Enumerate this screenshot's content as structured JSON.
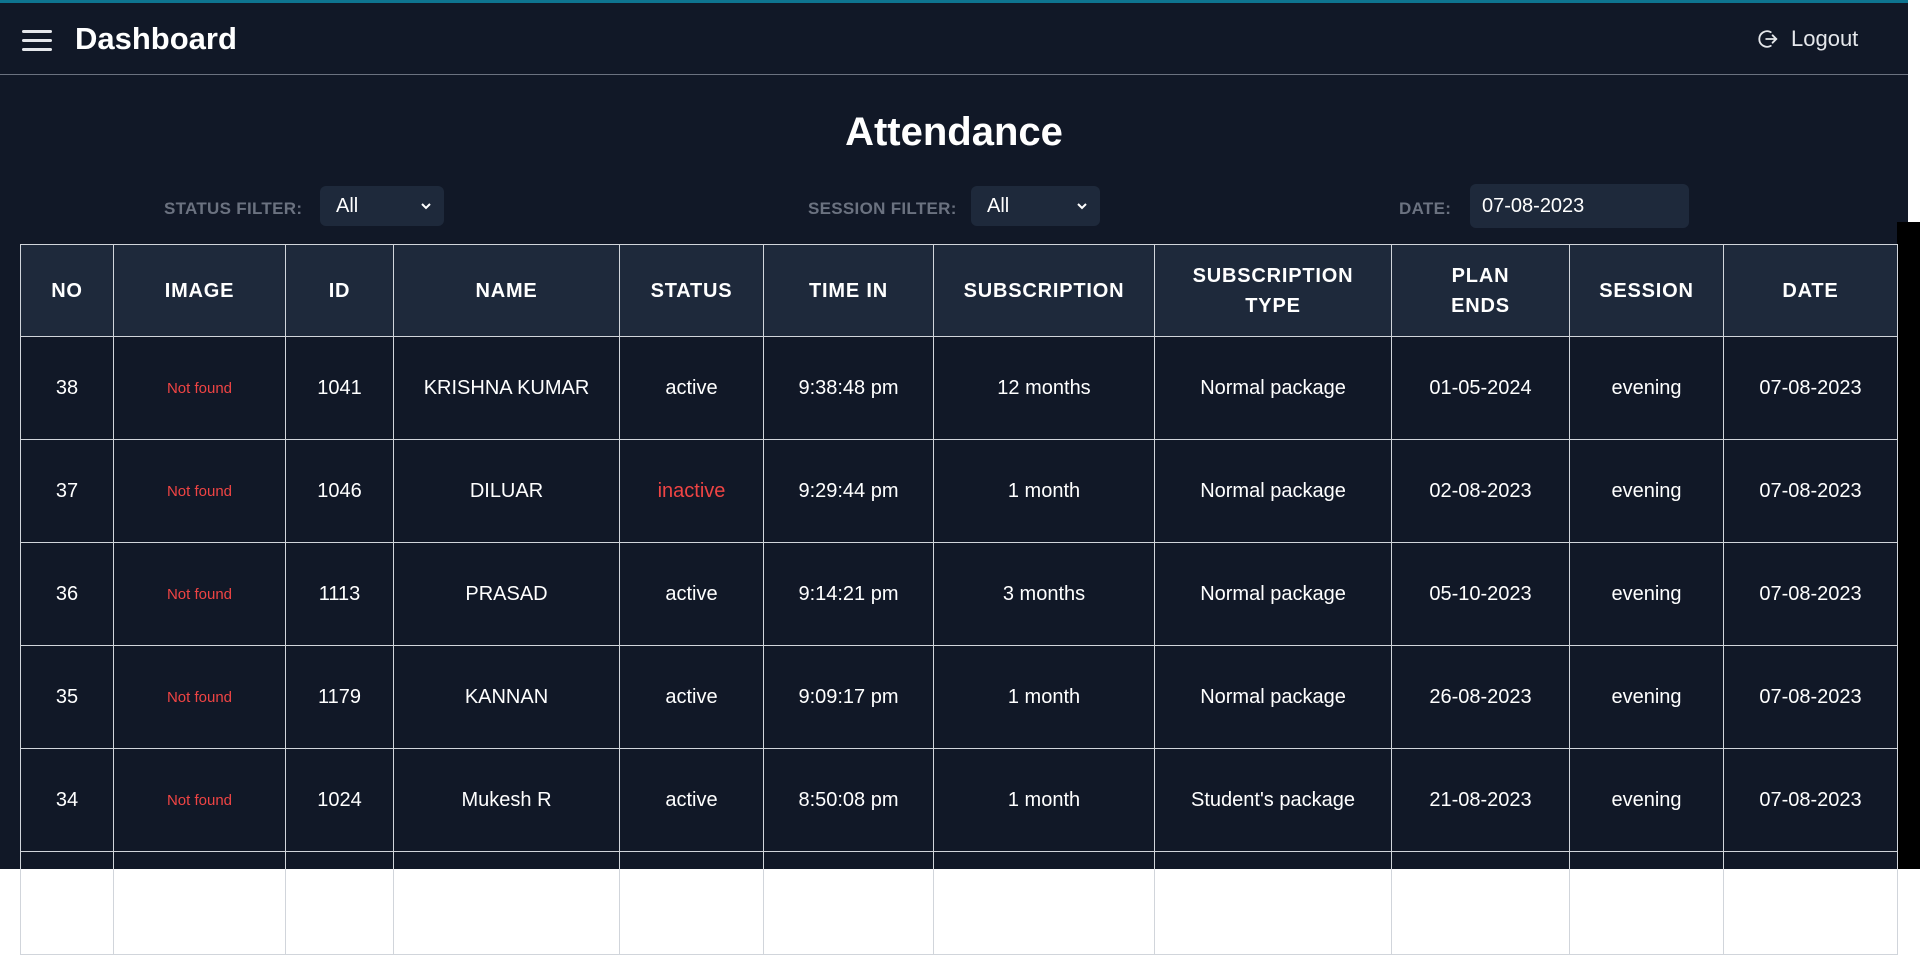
{
  "header": {
    "title": "Dashboard",
    "menu_icon": "hamburger-menu-icon",
    "logout_label": "Logout",
    "logout_icon": "logout-icon"
  },
  "page": {
    "title": "Attendance"
  },
  "filters": {
    "status_label": "STATUS FILTER:",
    "status_value": "All",
    "session_label": "SESSION FILTER:",
    "session_value": "All",
    "date_label": "DATE:",
    "date_value": "07-08-2023"
  },
  "table": {
    "headers": [
      "NO",
      "IMAGE",
      "ID",
      "NAME",
      "STATUS",
      "TIME IN",
      "SUBSCRIPTION",
      "SUBSCRIPTION TYPE",
      "PLAN ENDS",
      "SESSION",
      "DATE"
    ],
    "rows": [
      {
        "no": "38",
        "image": "Not found",
        "id": "1041",
        "name": "KRISHNA KUMAR",
        "status": "active",
        "time_in": "9:38:48 pm",
        "subscription": "12 months",
        "subscription_type": "Normal package",
        "plan_ends": "01-05-2024",
        "session": "evening",
        "date": "07-08-2023"
      },
      {
        "no": "37",
        "image": "Not found",
        "id": "1046",
        "name": "DILUAR",
        "status": "inactive",
        "time_in": "9:29:44 pm",
        "subscription": "1 month",
        "subscription_type": "Normal package",
        "plan_ends": "02-08-2023",
        "session": "evening",
        "date": "07-08-2023"
      },
      {
        "no": "36",
        "image": "Not found",
        "id": "1113",
        "name": "PRASAD",
        "status": "active",
        "time_in": "9:14:21 pm",
        "subscription": "3 months",
        "subscription_type": "Normal package",
        "plan_ends": "05-10-2023",
        "session": "evening",
        "date": "07-08-2023"
      },
      {
        "no": "35",
        "image": "Not found",
        "id": "1179",
        "name": "KANNAN",
        "status": "active",
        "time_in": "9:09:17 pm",
        "subscription": "1 month",
        "subscription_type": "Normal package",
        "plan_ends": "26-08-2023",
        "session": "evening",
        "date": "07-08-2023"
      },
      {
        "no": "34",
        "image": "Not found",
        "id": "1024",
        "name": "Mukesh R",
        "status": "active",
        "time_in": "8:50:08 pm",
        "subscription": "1 month",
        "subscription_type": "Student's package",
        "plan_ends": "21-08-2023",
        "session": "evening",
        "date": "07-08-2023"
      },
      {
        "no": "",
        "image": "",
        "id": "",
        "name": "",
        "status": "",
        "time_in": "",
        "subscription": "",
        "subscription_type": "",
        "plan_ends": "",
        "session": "",
        "date": ""
      }
    ]
  },
  "colors": {
    "background": "#111827",
    "header_cell": "#1e293b",
    "error_red": "#ef4444",
    "accent_top": "#0e7490"
  }
}
